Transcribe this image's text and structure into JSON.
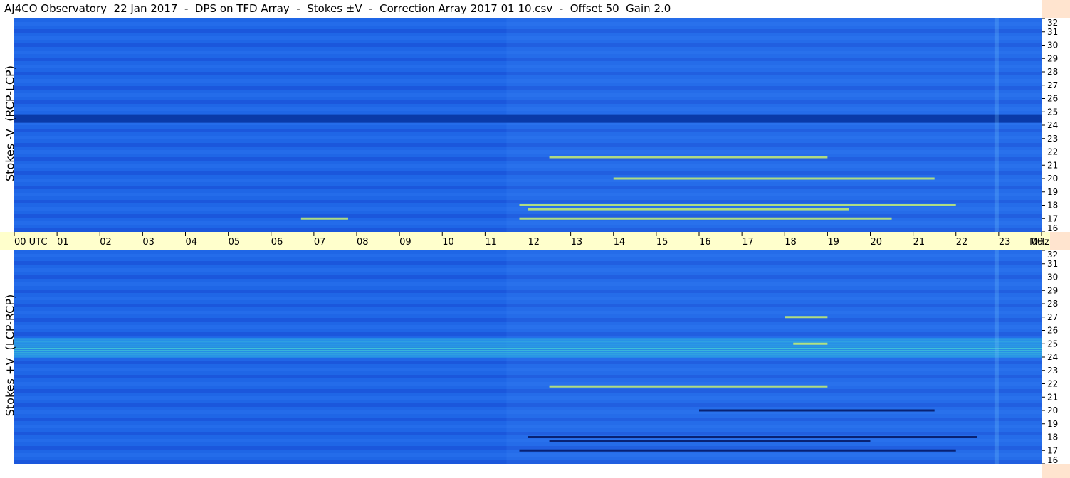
{
  "title": "AJ4CO Observatory  22 Jan 2017  -  DPS on TFD Array  -  Stokes ±V  -  Correction Array 2017 01 10.csv  -  Offset 50  Gain 2.0",
  "colors": {
    "background_blue": "#1f66e6",
    "dark_band": "#0a3aa8",
    "bright_band": "#3ec0d8",
    "time_bar": "#ffffcc",
    "right_strip": "#ffe4cf"
  },
  "chart_data": [
    {
      "type": "heatmap",
      "name": "top-panel",
      "ylabel": "Stokes -V  (RCP-LCP)",
      "x_axis": "UTC hours",
      "xlim": [
        0,
        24
      ],
      "y_axis": "MHz",
      "ylim": [
        16,
        32
      ],
      "yticks": [
        "32",
        "31",
        "30",
        "29",
        "28",
        "27",
        "26",
        "25",
        "24",
        "23",
        "22",
        "21",
        "20",
        "19",
        "18",
        "17",
        "16"
      ],
      "dark_bands_mhz": [
        24.5
      ],
      "bright_features": [
        {
          "mhz": 17.0,
          "utc_start": 11.8,
          "utc_end": 20.5
        },
        {
          "mhz": 17.7,
          "utc_start": 12.0,
          "utc_end": 19.5
        },
        {
          "mhz": 18.0,
          "utc_start": 11.8,
          "utc_end": 22.0
        },
        {
          "mhz": 20.0,
          "utc_start": 14.0,
          "utc_end": 21.5
        },
        {
          "mhz": 21.6,
          "utc_start": 12.5,
          "utc_end": 19.0
        },
        {
          "mhz": 17.0,
          "utc_start": 6.7,
          "utc_end": 7.8
        }
      ]
    },
    {
      "type": "heatmap",
      "name": "bottom-panel",
      "ylabel": "Stokes +V  (LCP-RCP)",
      "x_axis": "UTC hours",
      "xlim": [
        0,
        24
      ],
      "y_axis": "MHz",
      "ylim": [
        16,
        32
      ],
      "yticks": [
        "32",
        "31",
        "30",
        "29",
        "28",
        "27",
        "26",
        "25",
        "24",
        "23",
        "22",
        "21",
        "20",
        "19",
        "18",
        "17",
        "16"
      ],
      "bright_bands_mhz": [
        24.7
      ],
      "dark_features": [
        {
          "mhz": 17.0,
          "utc_start": 11.8,
          "utc_end": 22.0
        },
        {
          "mhz": 17.7,
          "utc_start": 12.5,
          "utc_end": 20.0
        },
        {
          "mhz": 20.0,
          "utc_start": 16.0,
          "utc_end": 21.5
        },
        {
          "mhz": 18.0,
          "utc_start": 12.0,
          "utc_end": 22.5
        }
      ],
      "bright_features": [
        {
          "mhz": 21.8,
          "utc_start": 12.5,
          "utc_end": 19.0
        },
        {
          "mhz": 25.0,
          "utc_start": 18.2,
          "utc_end": 19.0
        },
        {
          "mhz": 27.0,
          "utc_start": 18.0,
          "utc_end": 19.0
        }
      ]
    }
  ],
  "time_axis": {
    "labels": [
      "00  UTC",
      "01",
      "02",
      "03",
      "04",
      "05",
      "06",
      "07",
      "08",
      "09",
      "10",
      "11",
      "12",
      "13",
      "14",
      "15",
      "16",
      "17",
      "18",
      "19",
      "20",
      "21",
      "22",
      "23",
      "00"
    ],
    "unit": "MHz"
  }
}
